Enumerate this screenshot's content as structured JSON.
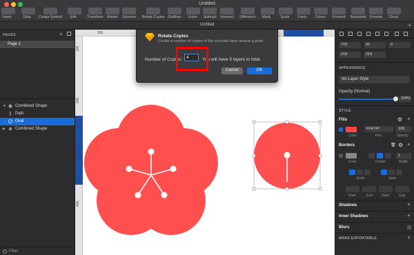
{
  "window": {
    "title": "Untitled",
    "tab_title": "Untitled"
  },
  "toolbar": [
    {
      "label": "Insert",
      "icon": "plus-icon"
    },
    {
      "label": "Data",
      "icon": "data-icon"
    },
    {
      "label": "Create Symbol",
      "icon": "symbol-icon"
    },
    {
      "label": "Edit",
      "icon": "edit-icon"
    },
    {
      "label": "Transform",
      "icon": "transform-icon"
    },
    {
      "label": "Rotate",
      "icon": "rotate-icon"
    },
    {
      "label": "Scissors",
      "icon": "scissors-icon"
    },
    {
      "label": "Rotate Copies",
      "icon": "rotate-copies-icon"
    },
    {
      "label": "Outlines",
      "icon": "outlines-icon"
    },
    {
      "label": "Union",
      "icon": "union-icon"
    },
    {
      "label": "Subtract",
      "icon": "subtract-icon"
    },
    {
      "label": "Intersect",
      "icon": "intersect-icon"
    },
    {
      "label": "Difference",
      "icon": "difference-icon"
    },
    {
      "label": "Mask",
      "icon": "mask-icon"
    },
    {
      "label": "Scale",
      "icon": "scale-icon"
    },
    {
      "label": "Fonts",
      "icon": "fonts-icon"
    },
    {
      "label": "Colors",
      "icon": "colors-icon"
    },
    {
      "label": "Forward",
      "icon": "forward-icon"
    },
    {
      "label": "Backward",
      "icon": "backward-icon"
    },
    {
      "label": "Preview",
      "icon": "preview-icon"
    },
    {
      "label": "Cloud",
      "icon": "cloud-icon"
    }
  ],
  "pages": {
    "header": "PAGES",
    "items": [
      "Page 1"
    ]
  },
  "layers": [
    {
      "label": "Combined Shape",
      "expanded": true
    },
    {
      "label": "Path"
    },
    {
      "label": "Oval",
      "selected": true
    },
    {
      "label": "Combined Shape",
      "expanded": false
    }
  ],
  "filter_label": "Filter",
  "rulers": {
    "h": [
      "200",
      "300",
      "400",
      "500",
      "600"
    ],
    "v": [
      "100",
      "200",
      "300",
      "400"
    ]
  },
  "dialog": {
    "title": "Rotate Copies",
    "subtitle": "Create a number of copies of the selected layer around a point.",
    "field_label": "Number of Copies:",
    "field_value": "4",
    "hint": "You will have 5 layers in total.",
    "cancel": "Cancel",
    "ok": "OK"
  },
  "inspector": {
    "x": "723",
    "y": "20",
    "rotation": "0",
    "width": "219",
    "height": "219",
    "appearance_header": "APPEARANCE",
    "layer_style": "No Layer Style",
    "opacity_label": "Opacity (Normal)",
    "opacity_value": "100%",
    "opacity": 1.0,
    "style_header": "STYLE",
    "fills_header": "Fills",
    "fill_hex": "FF4747",
    "fill_opacity": "100",
    "fill_color": "#ff4747",
    "fill_labels": {
      "color": "Color",
      "hex": "Hex",
      "opacity": "Opacity"
    },
    "borders_header": "Borders",
    "border_width": "1",
    "border_labels": {
      "color": "Color",
      "position": "Center",
      "width": "Width"
    },
    "ends_label": "Ends",
    "joins_label": "Joins",
    "dash_labels": [
      "Start",
      "End",
      "Dash",
      "Gap"
    ],
    "shadows": "Shadows",
    "inner_shadows": "Inner Shadows",
    "blurs": "Blurs",
    "make_exportable": "MAKE EXPORTABLE"
  },
  "colors": {
    "accent": "#1a6dd9",
    "shape": "#ff4f4f",
    "highlight": "#ff0000"
  }
}
